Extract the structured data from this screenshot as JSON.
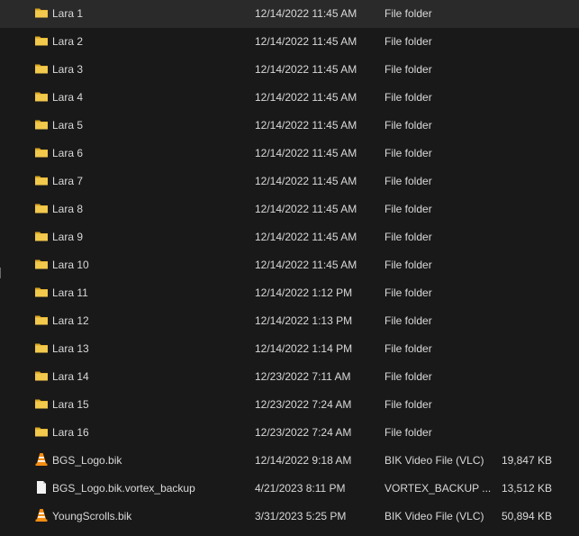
{
  "files": [
    {
      "name": "Lara 1",
      "date": "12/14/2022 11:45 AM",
      "type": "File folder",
      "size": "",
      "icon": "folder-icon"
    },
    {
      "name": "Lara 2",
      "date": "12/14/2022 11:45 AM",
      "type": "File folder",
      "size": "",
      "icon": "folder-icon"
    },
    {
      "name": "Lara 3",
      "date": "12/14/2022 11:45 AM",
      "type": "File folder",
      "size": "",
      "icon": "folder-icon"
    },
    {
      "name": "Lara 4",
      "date": "12/14/2022 11:45 AM",
      "type": "File folder",
      "size": "",
      "icon": "folder-icon"
    },
    {
      "name": "Lara 5",
      "date": "12/14/2022 11:45 AM",
      "type": "File folder",
      "size": "",
      "icon": "folder-icon"
    },
    {
      "name": "Lara 6",
      "date": "12/14/2022 11:45 AM",
      "type": "File folder",
      "size": "",
      "icon": "folder-icon"
    },
    {
      "name": "Lara 7",
      "date": "12/14/2022 11:45 AM",
      "type": "File folder",
      "size": "",
      "icon": "folder-icon"
    },
    {
      "name": "Lara 8",
      "date": "12/14/2022 11:45 AM",
      "type": "File folder",
      "size": "",
      "icon": "folder-icon"
    },
    {
      "name": "Lara 9",
      "date": "12/14/2022 11:45 AM",
      "type": "File folder",
      "size": "",
      "icon": "folder-icon"
    },
    {
      "name": "Lara 10",
      "date": "12/14/2022 11:45 AM",
      "type": "File folder",
      "size": "",
      "icon": "folder-icon"
    },
    {
      "name": "Lara 11",
      "date": "12/14/2022 1:12 PM",
      "type": "File folder",
      "size": "",
      "icon": "folder-icon"
    },
    {
      "name": "Lara 12",
      "date": "12/14/2022 1:13 PM",
      "type": "File folder",
      "size": "",
      "icon": "folder-icon"
    },
    {
      "name": "Lara 13",
      "date": "12/14/2022 1:14 PM",
      "type": "File folder",
      "size": "",
      "icon": "folder-icon"
    },
    {
      "name": "Lara 14",
      "date": "12/23/2022 7:11 AM",
      "type": "File folder",
      "size": "",
      "icon": "folder-icon"
    },
    {
      "name": "Lara 15",
      "date": "12/23/2022 7:24 AM",
      "type": "File folder",
      "size": "",
      "icon": "folder-icon"
    },
    {
      "name": "Lara 16",
      "date": "12/23/2022 7:24 AM",
      "type": "File folder",
      "size": "",
      "icon": "folder-icon"
    },
    {
      "name": "BGS_Logo.bik",
      "date": "12/14/2022 9:18 AM",
      "type": "BIK Video File (VLC)",
      "size": "19,847 KB",
      "icon": "vlc-cone-icon"
    },
    {
      "name": "BGS_Logo.bik.vortex_backup",
      "date": "4/21/2023 8:11 PM",
      "type": "VORTEX_BACKUP ...",
      "size": "13,512 KB",
      "icon": "blank-file-icon"
    },
    {
      "name": "YoungScrolls.bik",
      "date": "3/31/2023 5:25 PM",
      "type": "BIK Video File (VLC)",
      "size": "50,894 KB",
      "icon": "vlc-cone-icon"
    }
  ],
  "colors": {
    "background": "#191919",
    "text": "#d9d9d9",
    "folder": "#f2c94c",
    "folder_dark": "#d9a520",
    "vlc_orange": "#f28c13",
    "file_white": "#f2f2f2"
  }
}
